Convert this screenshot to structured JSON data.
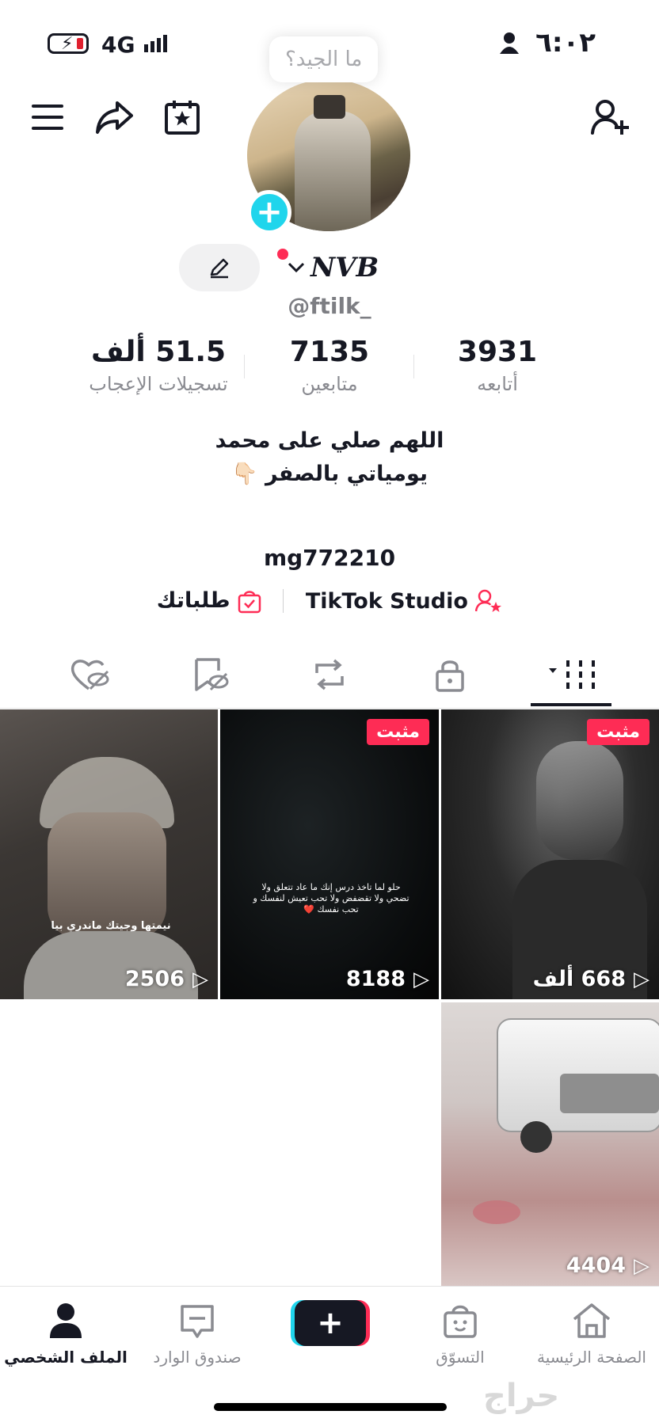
{
  "status_bar": {
    "time": "٦:٠٢",
    "network": "4G"
  },
  "header": {
    "tooltip": "ما الجيد؟"
  },
  "profile": {
    "name": "NVB",
    "username": "@ftilk_",
    "stats": [
      {
        "value": "3931",
        "label": "أتابعه"
      },
      {
        "value": "7135",
        "label": "متابعين"
      },
      {
        "value": "51.5 ألف",
        "label": "تسجيلات الإعجاب"
      }
    ],
    "bio_lines": [
      "اللهم صلي على محمد",
      "يومياتي بالصفر 👇🏻"
    ],
    "link_id": "mg772210",
    "tools": {
      "studio": "TikTok Studio",
      "orders": "طلباتك"
    }
  },
  "videos": [
    {
      "views": "668 ألف",
      "pinned": "مثبت",
      "caption": ""
    },
    {
      "views": "8188",
      "pinned": "مثبت",
      "caption": "حلو لما تاخذ درس إنك ما عاد تتعلق ولا تضحي ولا تقضفض ولا تحب تعيش لنفسك و تحب نفسك ❤️"
    },
    {
      "views": "2506",
      "pinned": "",
      "caption": "نيمتها وجيتك ماندري بيا"
    },
    {
      "views": "4404",
      "pinned": "",
      "caption": ""
    }
  ],
  "bottom_nav": [
    {
      "label": "الصفحة الرئيسية",
      "icon": "home-icon"
    },
    {
      "label": "التسوّق",
      "icon": "shop-icon"
    },
    {
      "label": "",
      "icon": "create-icon"
    },
    {
      "label": "صندوق الوارد",
      "icon": "inbox-icon"
    },
    {
      "label": "الملف الشخصي",
      "icon": "profile-icon"
    }
  ],
  "watermark": "حراج"
}
